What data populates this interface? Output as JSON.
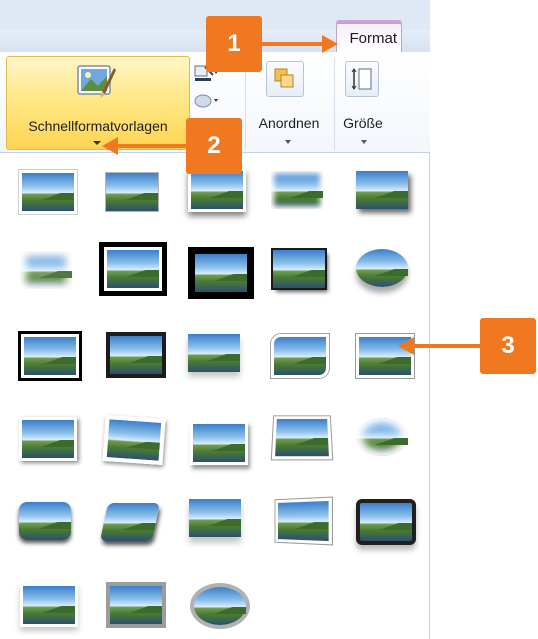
{
  "ribbon": {
    "format_tab_label": "Format",
    "quick_styles_label": "Schnellformatvorlagen",
    "arrange_label": "Anordnen",
    "size_label": "Größe"
  },
  "callouts": {
    "one": "1",
    "two": "2",
    "three": "3"
  },
  "gallery": {
    "rows": [
      [
        "Einfacher Rahmen, weiß",
        "Einfaches Rechteck",
        "Rahmen mit Schatten",
        "Weiche Kante Rechteck",
        "Schattiertes Rechteck"
      ],
      [
        "Weiche Kante",
        "Doppelrahmen, schwarz",
        "Dicker Rahmen, schwarz",
        "Schlagschatten, Rechteck",
        "Oval mit Spiegelung"
      ],
      [
        "Einfacher Rahmen, schwarz",
        "Metallrahmen",
        "Reflektiertes Rechteck",
        "Abgerundete diagonale Ecke",
        "Abgeschnittene diagonale Ecke"
      ],
      [
        "Einfacher Rahmen, weiß mit Schatten",
        "Gedrehter Rahmen, weiß",
        "Perspektive mit Schatten",
        "Perspektive, relief",
        "Weiche Kante, oval"
      ],
      [
        "Relief, abgerundet",
        "Perspektive, abgeschrägt",
        "Reflektiert, weiche Kante",
        "Perspektive links, weiß",
        "Metallrahmen, abgerundet"
      ],
      [
        "Weißer Rahmen mit Spiegelung",
        "Metallrahmen, Rechteck",
        "Metall, oval"
      ]
    ]
  },
  "colors": {
    "callout": "#f07820",
    "selected_button": "#ffd451",
    "format_tab_accent": "#cfa3d8"
  }
}
